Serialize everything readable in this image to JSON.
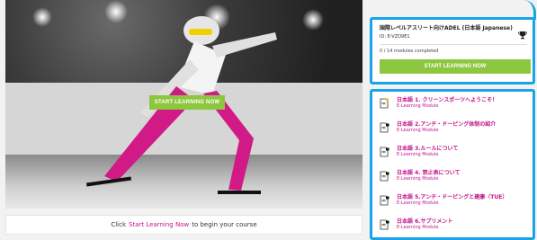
{
  "hero": {
    "cta_label": "START LEARNING NOW"
  },
  "begin_bar": {
    "prefix": "Click",
    "link": "Start Learning Now",
    "suffix": "to begin your course"
  },
  "course": {
    "title": "国際レベルアスリート向けADEL (日本語 Japanese)",
    "id": "ID: E-VZO9E1",
    "progress": "0 / 14 modules completed",
    "cta_label": "START LEARNING NOW"
  },
  "modules": [
    {
      "title": "日本語 1. クリーンスポーツへようこそ！",
      "type": "E-Learning Module",
      "icon": "document-unlocked-icon"
    },
    {
      "title": "日本語 2.アンチ・ドーピング体制の紹介",
      "type": "E-Learning Module",
      "icon": "document-lock-icon"
    },
    {
      "title": "日本語 3.ルールについて",
      "type": "E-Learning Module",
      "icon": "document-lock-icon"
    },
    {
      "title": "日本語 4. 禁止表について",
      "type": "E-Learning Module",
      "icon": "document-lock-icon"
    },
    {
      "title": "日本語 5.アンチ・ドーピングと建康（TUE）",
      "type": "E-Learning Module",
      "icon": "document-lock-icon"
    },
    {
      "title": "日本語 6.サプリメント",
      "type": "E-Learning Module",
      "icon": "document-lock-icon"
    }
  ],
  "colors": {
    "accent_green": "#8dc63f",
    "highlight_blue": "#1aa3e8",
    "module_magenta": "#c2168c"
  }
}
